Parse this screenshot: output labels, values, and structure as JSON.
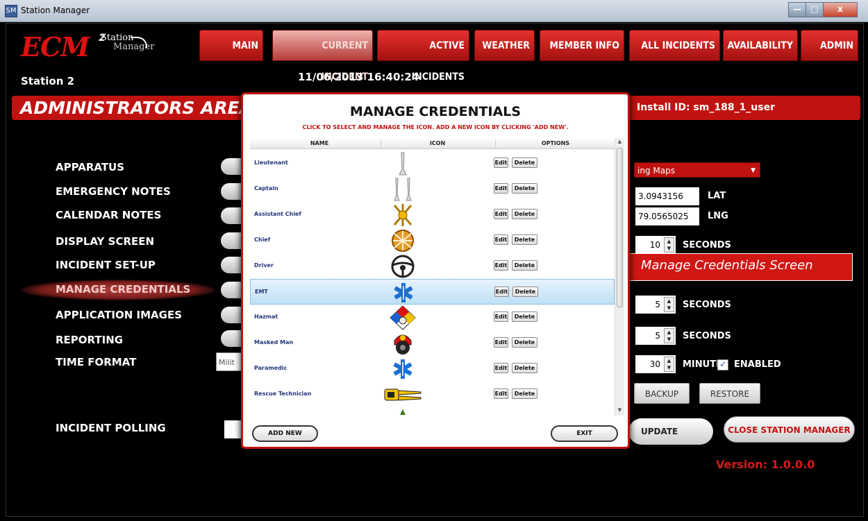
{
  "window": {
    "title": "Station Manager",
    "app_icon": "SM",
    "min": "—",
    "max": "□",
    "close": "x"
  },
  "logo": {
    "text": "ECM",
    "sup": "2",
    "sub1": "Station",
    "sub2": "Manager"
  },
  "nav": [
    "MAIN",
    "CURRENT INCIDENT",
    "ACTIVE INCIDENTS",
    "WEATHER",
    "MEMBER INFO",
    "ALL INCIDENTS",
    "AVAILABILITY",
    "ADMIN"
  ],
  "nav_active_index": 1,
  "station": "Station 2",
  "datetime": "11/06/2013 16:40:24",
  "admin_title": "ADMINISTRATORS AREA",
  "install_id": "Install ID: sm_188_1_user",
  "admin_menu": [
    "APPARATUS",
    "EMERGENCY NOTES",
    "CALENDAR NOTES",
    "DISPLAY SCREEN",
    "INCIDENT SET-UP",
    "MANAGE CREDENTIALS",
    "APPLICATION IMAGES",
    "REPORTING",
    "TIME FORMAT"
  ],
  "admin_menu_selected": "MANAGE CREDENTIALS",
  "time_format_value": "Milit",
  "incident_polling_label": "INCIDENT POLLING",
  "right_panel": {
    "map_dropdown": "ing Maps",
    "lat_value": "3.0943156",
    "lat_label": "LAT",
    "lng_value": "79.0565025",
    "lng_label": "LNG",
    "spin1_value": "10",
    "spin1_unit": "SECONDS",
    "spin2_value": "5",
    "spin2_unit": "SECONDS",
    "spin3_value": "5",
    "spin3_unit": "SECONDS",
    "spin4_value": "30",
    "spin4_unit": "MINUTES",
    "enabled_label": "ENABLED",
    "enabled_checked": true,
    "backup": "BACKUP",
    "restore": "RESTORE",
    "update": "UPDATE",
    "close_station": "CLOSE STATION MANAGER",
    "version": "Version:  1.0.0.0"
  },
  "callout": "Manage Credentials Screen",
  "modal": {
    "title": "MANAGE CREDENTIALS",
    "subtitle": "CLICK TO SELECT AND MANAGE THE ICON.  ADD A NEW ICON BY CLICKING 'ADD NEW'.",
    "col_name": "NAME",
    "col_icon": "ICON",
    "col_options": "OPTIONS",
    "edit": "Edit",
    "delete": "Delete",
    "rows": [
      {
        "name": "Lieutenant",
        "icon": "lieutenant-bugle-icon"
      },
      {
        "name": "Captain",
        "icon": "captain-bugles-icon"
      },
      {
        "name": "Assistant Chief",
        "icon": "assistant-chief-bugles-icon"
      },
      {
        "name": "Chief",
        "icon": "chief-bugles-icon"
      },
      {
        "name": "Driver",
        "icon": "steering-wheel-icon"
      },
      {
        "name": "EMT",
        "icon": "star-of-life-icon"
      },
      {
        "name": "Hazmat",
        "icon": "hazmat-diamond-icon"
      },
      {
        "name": "Masked Man",
        "icon": "firefighter-mask-icon"
      },
      {
        "name": "Paramedic",
        "icon": "paramedic-star-icon"
      },
      {
        "name": "Rescue Technician",
        "icon": "rescue-tools-icon"
      }
    ],
    "selected_row": "EMT",
    "add_new": "ADD NEW",
    "exit": "EXIT"
  }
}
